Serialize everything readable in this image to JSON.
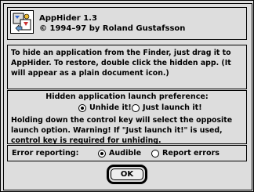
{
  "header": {
    "icon": "apphider-app-icon",
    "app_name": "AppHider 1.3",
    "copyright": "© 1994–97 by Roland Gustafsson"
  },
  "info": {
    "text": "To hide an application from the Finder, just drag it to AppHider.  To restore, double click the hidden app.  (It will appear as a plain document icon.)"
  },
  "preference": {
    "heading": "Hidden application launch preference:",
    "options": [
      {
        "label": "Unhide it!",
        "selected": true
      },
      {
        "label": "Just launch it!",
        "selected": false
      }
    ],
    "warning": "Holding down the control key will select the opposite launch option.  Warning!  If \"Just launch it!\" is used, control key is required for unhiding."
  },
  "error_reporting": {
    "label": "Error reporting:",
    "options": [
      {
        "label": "Audible",
        "selected": true
      },
      {
        "label": "Report errors",
        "selected": false
      }
    ]
  },
  "ok_button": {
    "label": "OK"
  }
}
